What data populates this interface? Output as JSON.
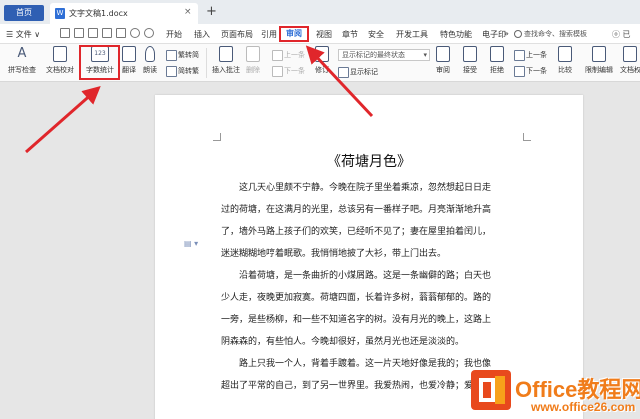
{
  "titlebar": {
    "home_tab": "首页",
    "doc_tab": "文字文稿1.docx",
    "doc_icon_letter": "W",
    "close": "×",
    "new_tab": "+"
  },
  "menubar": {
    "file": "☰ 文件 ∨",
    "items": [
      "开始",
      "插入",
      "页面布局",
      "引用",
      "审阅",
      "视图",
      "章节",
      "安全",
      "开发工具",
      "特色功能",
      "电子印"
    ],
    "more": "»",
    "search": "查找命令、搜索模板",
    "right_icons": "ⓞ 已"
  },
  "ribbon": {
    "spell_check": "拼写检查",
    "doc_compare": "文档校对",
    "word_count": "字数统计",
    "translate": "翻译",
    "read_aloud": "朗读",
    "trad_to_simp": "繁转简",
    "simp_to_trad": "简转繁",
    "insert_comment": "插入批注",
    "delete": "删除",
    "prev": "上一条",
    "next": "下一条",
    "revise": "修订",
    "markup_dropdown": "显示标记的最终状态",
    "show_markup": "显示标记",
    "review": "审阅",
    "accept": "接受",
    "reject": "拒绝",
    "prev_change": "上一条",
    "next_change": "下一条",
    "compare": "比较",
    "restrict_edit": "限制编辑",
    "doc_rights": "文档权"
  },
  "document": {
    "title": "《荷塘月色》",
    "paragraphs": [
      [
        "这几天心里颇不宁静。今晚在院子里坐着乘凉，忽然想起日日走",
        "过的荷塘，在这满月的光里，总该另有一番样子吧。月亮渐渐地升高",
        "了，墙外马路上孩子们的欢笑，已经听不见了；妻在屋里拍着闰儿，",
        "迷迷糊糊地哼着眠歌。我悄悄地披了大衫，带上门出去。"
      ],
      [
        "沿着荷塘，是一条曲折的小煤屑路。这是一条幽僻的路；白天也",
        "少人走，夜晚更加寂寞。荷塘四面，长着许多树，蓊蓊郁郁的。路的",
        "一旁，是些杨柳，和一些不知道名字的树。没有月光的晚上，这路上",
        "阴森森的，有些怕人。今晚却很好，虽然月光也还是淡淡的。"
      ],
      [
        "路上只我一个人，背着手踱着。这一片天地好像是我的；我也像",
        "超出了平常的自己，到了另一世界里。我爱热闹，也爱冷静；爱群居"
      ]
    ]
  },
  "watermark": {
    "logo_text": "Office教程网",
    "logo_url": "www.office26.com"
  },
  "colors": {
    "accent_blue": "#2f5fb3",
    "highlight_red": "#e0262b",
    "logo_orange": "#f07c1a"
  }
}
